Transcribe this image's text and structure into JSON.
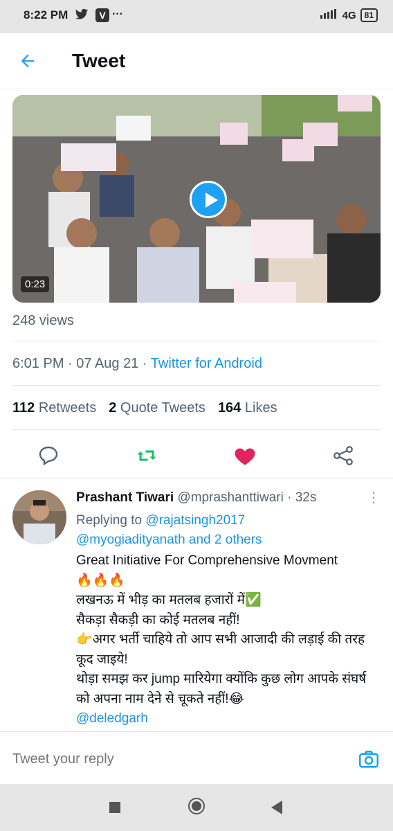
{
  "status_bar": {
    "time": "8:22 PM",
    "network": "4G",
    "battery": "81",
    "colors": {
      "bg": "#e6e6e6"
    }
  },
  "header": {
    "title": "Tweet"
  },
  "tweet": {
    "video": {
      "duration": "0:23"
    },
    "views": "248 views",
    "timestamp": "6:01 PM · 07 Aug 21 · ",
    "source": "Twitter for Android",
    "stats": {
      "retweets_count": "112",
      "retweets_label": "Retweets",
      "quotes_count": "2",
      "quotes_label": "Quote Tweets",
      "likes_count": "164",
      "likes_label": "Likes"
    },
    "liked": true,
    "colors": {
      "accent": "#1da1f2",
      "like": "#e0245e",
      "retweet": "#17bf63"
    }
  },
  "reply": {
    "author_name": "Prashant Tiwari",
    "author_handle": "@mprashanttiwari",
    "time": " · 32s",
    "replying_to_label": "Replying to ",
    "replying_to_user": "@rajatsingh2017",
    "replying_to_more": "@myogiadityanath and 2 others",
    "body_lines": [
      "Great Initiative For Comprehensive Movment",
      "🔥🔥🔥",
      "लखनऊ में भीड़ का मतलब हजारों में✅",
      "सैकड़ा सैकड़ी का कोई मतलब नहीं!",
      "👉अगर भर्ती चाहिये तो आप सभी आजादी की लड़ाई की तरह कूद जाइये!",
      "थोड़ा समझ कर jump मारियेगा क्योंकि कुछ लोग आपके संघर्ष को अपना नाम देने से चूकते नहीं!😂"
    ],
    "mention": "@deledgarh"
  },
  "compose": {
    "placeholder": "Tweet your reply"
  }
}
